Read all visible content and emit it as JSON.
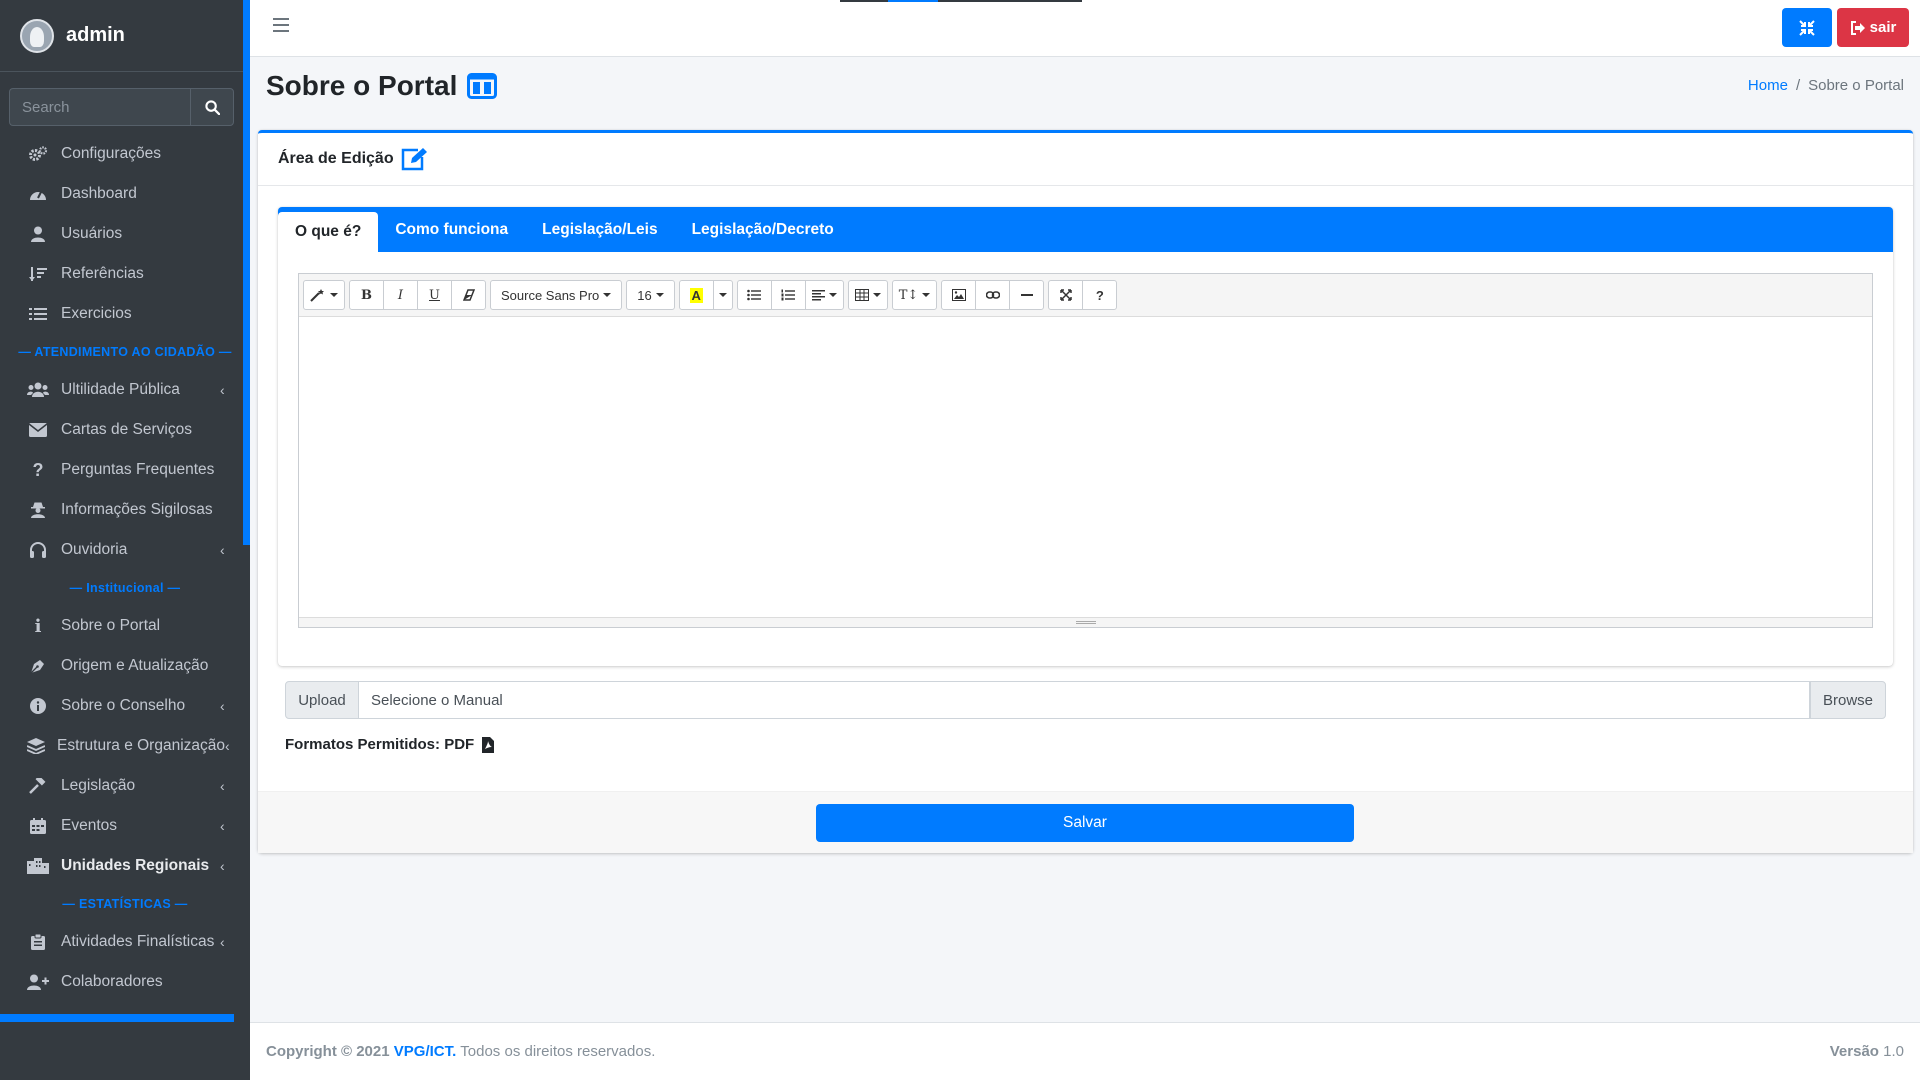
{
  "sidebar": {
    "brand": "admin",
    "search_placeholder": "Search",
    "items": [
      {
        "label": "Configurações"
      },
      {
        "label": "Dashboard"
      },
      {
        "label": "Usuários"
      },
      {
        "label": "Referências"
      },
      {
        "label": "Exercicios"
      },
      {
        "header": "— ATENDIMENTO AO CIDADÃO —"
      },
      {
        "label": "Ultilidade Pública"
      },
      {
        "label": "Cartas de Serviços"
      },
      {
        "label": "Perguntas Frequentes"
      },
      {
        "label": "Informações Sigilosas"
      },
      {
        "label": "Ouvidoria"
      },
      {
        "header": "— Institucional —"
      },
      {
        "label": "Sobre o Portal"
      },
      {
        "label": "Origem e Atualização"
      },
      {
        "label": "Sobre o Conselho"
      },
      {
        "label": "Estrutura e Organização"
      },
      {
        "label": "Legislação"
      },
      {
        "label": "Eventos"
      },
      {
        "label": "Unidades Regionais"
      },
      {
        "header": "— ESTATÍSTICAS —"
      },
      {
        "label": "Atividades Finalísticas"
      },
      {
        "label": "Colaboradores"
      }
    ]
  },
  "topbar": {
    "logout_label": "sair"
  },
  "page": {
    "title": "Sobre o Portal",
    "breadcrumb": [
      "Home",
      "Sobre o Portal"
    ]
  },
  "card": {
    "header": "Área de Edição",
    "tabs": [
      "O que é?",
      "Como funciona",
      "Legislação/Leis",
      "Legislação/Decreto"
    ],
    "toolbar": {
      "font_name": "Source Sans Pro",
      "font_size": "16"
    },
    "upload": {
      "label": "Upload",
      "placeholder": "Selecione o Manual",
      "browse": "Browse"
    },
    "formats": "Formatos Permitidos: PDF",
    "save_label": "Salvar"
  },
  "footer": {
    "copyright": "Copyright © 2021",
    "org": "VPG/ICT.",
    "rights": "Todos os direitos reservados.",
    "version_label": "Versão",
    "version": "1.0"
  },
  "colors": {
    "primary": "#007bff",
    "danger": "#dc3545",
    "sidebar_bg": "#343a40"
  }
}
